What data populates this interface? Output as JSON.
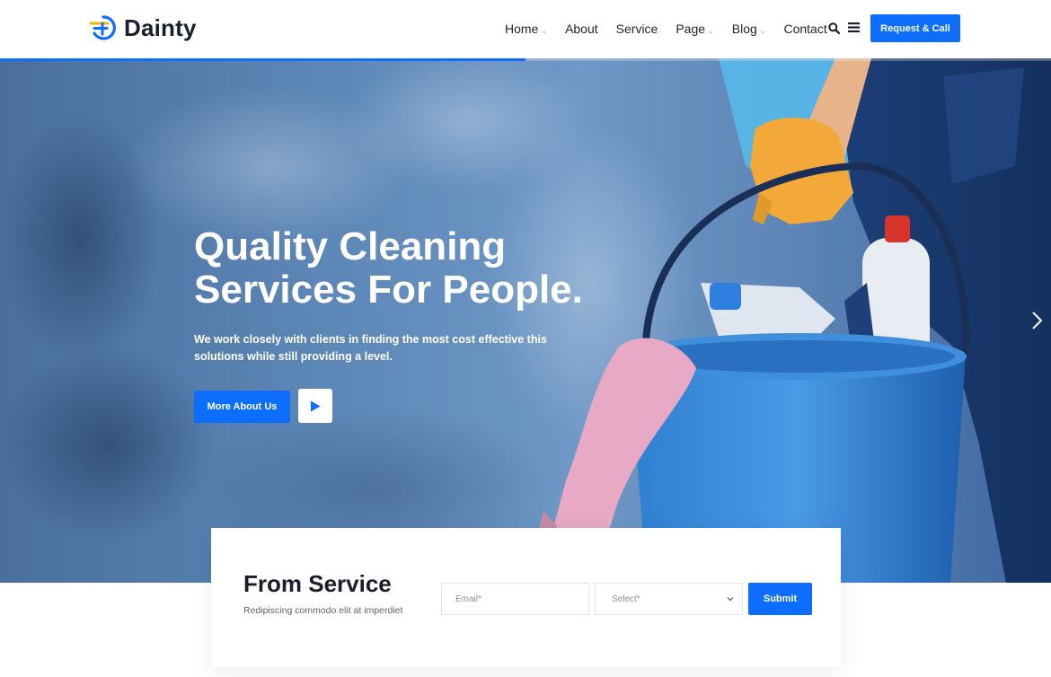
{
  "brand": {
    "name": "Dainty",
    "accent": "#0d6efd",
    "logo_icon": "dainty-logo-icon"
  },
  "nav": {
    "items": [
      {
        "label": "Home",
        "has_dropdown": true
      },
      {
        "label": "About",
        "has_dropdown": false
      },
      {
        "label": "Service",
        "has_dropdown": false
      },
      {
        "label": "Page",
        "has_dropdown": true
      },
      {
        "label": "Blog",
        "has_dropdown": true
      },
      {
        "label": "Contact",
        "has_dropdown": false
      }
    ],
    "search_icon": "search-icon",
    "menu_icon": "hamburger-menu-icon",
    "cta_label": "Request & Call"
  },
  "hero": {
    "title_line1": "Quality Cleaning",
    "title_line2": "Services For People.",
    "desc_line1": "We work closely with clients in finding the most cost effective this",
    "desc_line2": "solutions while still providing a level.",
    "button_label": "More About Us",
    "play_icon": "play-icon",
    "next_icon": "chevron-right-icon",
    "slide_progress": 0.5
  },
  "service_form": {
    "title": "From Service",
    "subtitle": "Redipiscing commodo elit at imperdiet",
    "email_placeholder": "Email*",
    "select_value": "Select*",
    "submit_label": "Submit"
  }
}
